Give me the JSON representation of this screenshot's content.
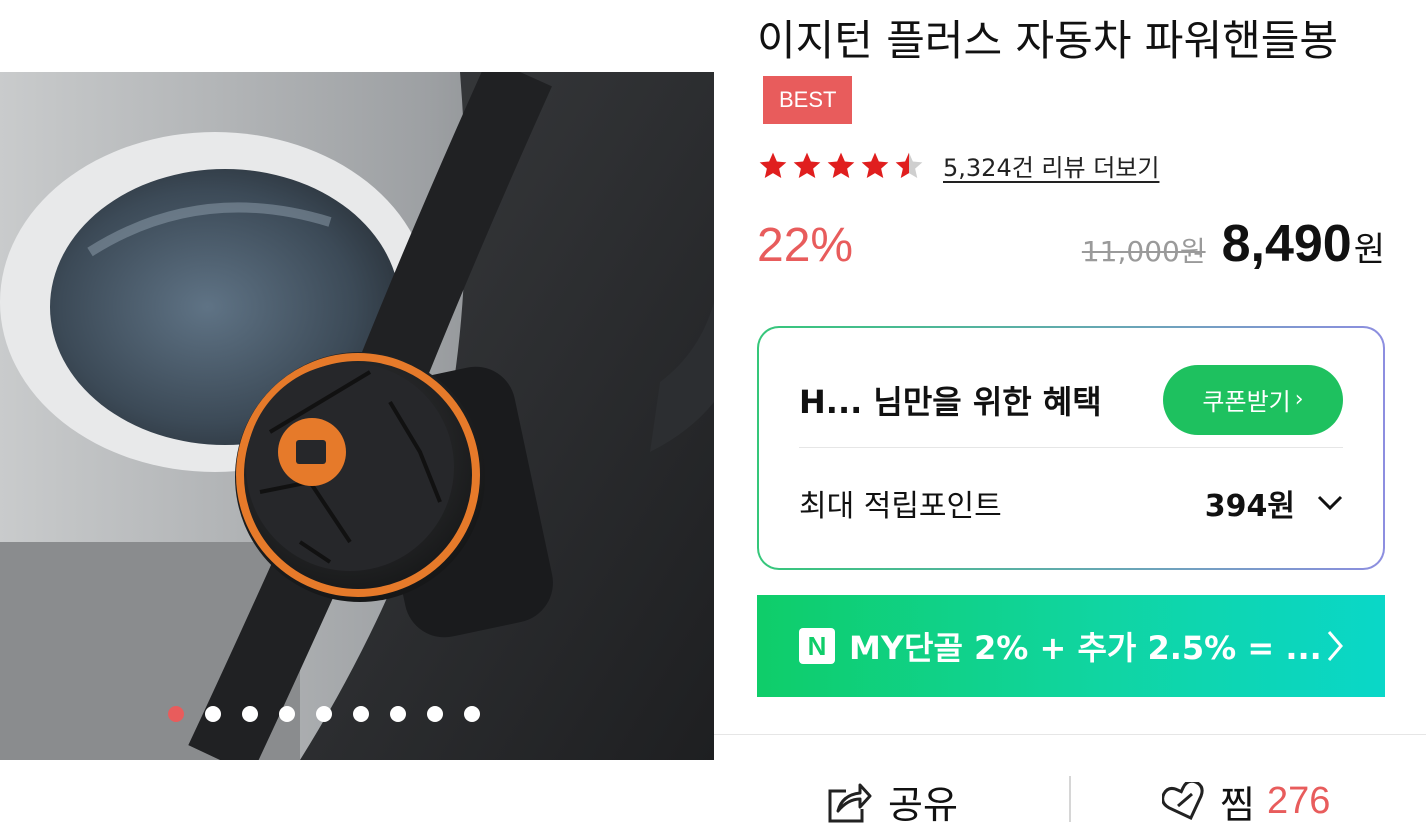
{
  "product": {
    "title": "이지턴 플러스 자동차 파워핸들봉",
    "badge": "BEST",
    "rating": 4.5,
    "review_link": "5,324건 리뷰 더보기",
    "discount": "22%",
    "original_price": "11,000원",
    "sale_price": "8,490",
    "currency": "원"
  },
  "gallery": {
    "image_count": 9,
    "active_index": 0,
    "accent_color": "#e85c5c"
  },
  "benefit": {
    "title": "H... 님만을 위한 혜택",
    "coupon_button": "쿠폰받기",
    "points_label": "최대 적립포인트",
    "points_value": "394원"
  },
  "npay": {
    "badge": "N",
    "text": "MY단골 2% + 추가 2.5% = ..."
  },
  "actions": {
    "share_label": "공유",
    "wish_label": "찜",
    "wish_count": "276"
  },
  "colors": {
    "accent_red": "#e85c5c",
    "green": "#1ec15f",
    "banner_start": "#0fcd69",
    "banner_end": "#0ad7c8"
  }
}
